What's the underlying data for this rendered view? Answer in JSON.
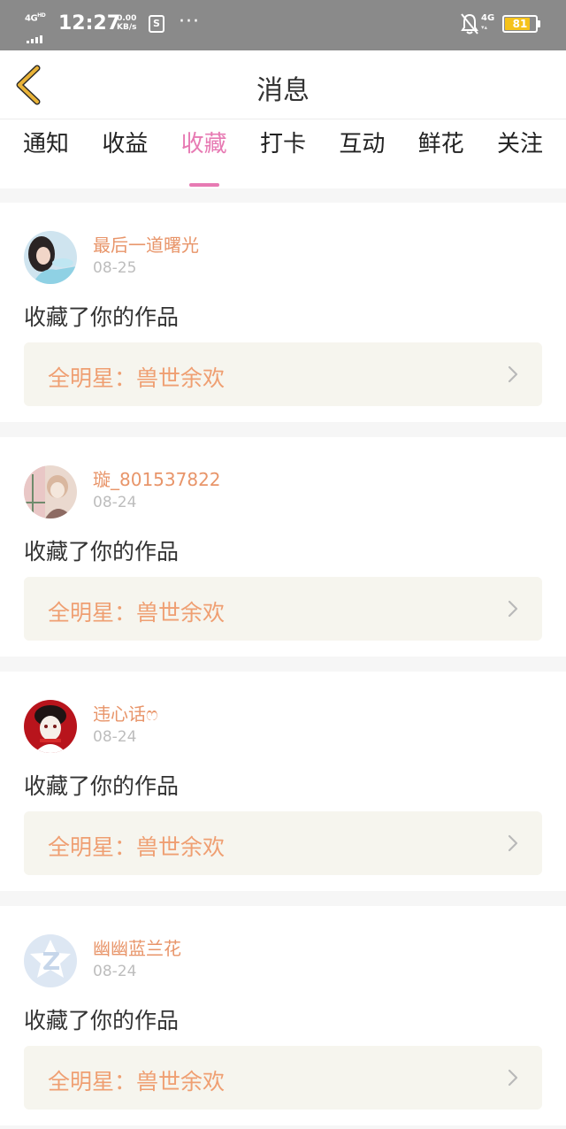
{
  "status_bar": {
    "network": "4G",
    "network_sup": "HD",
    "time": "12:27",
    "speed_value": "0.00",
    "speed_unit": "KB/s",
    "more": "···",
    "network_right": "4G",
    "battery": "81",
    "battery_level": 0.81,
    "battery_color": "#f5c21a"
  },
  "header": {
    "title": "消息",
    "back_icon": "chevron-left-icon",
    "back_color": "#e9b338"
  },
  "tabs": [
    {
      "label": "通知",
      "active": false
    },
    {
      "label": "收益",
      "active": false
    },
    {
      "label": "收藏",
      "active": true
    },
    {
      "label": "打卡",
      "active": false
    },
    {
      "label": "互动",
      "active": false
    },
    {
      "label": "鲜花",
      "active": false
    },
    {
      "label": "关注",
      "active": false
    }
  ],
  "accent_color": "#e77ab3",
  "messages": [
    {
      "name": "最后一道曙光",
      "date": "08-25",
      "action": "收藏了你的作品",
      "work": "全明星：兽世余欢",
      "avatar": "photo-avatar"
    },
    {
      "name": "璇_801537822",
      "date": "08-24",
      "action": "收藏了你的作品",
      "work": "全明星：兽世余欢",
      "avatar": "illustration-avatar"
    },
    {
      "name": "违心话ෆ",
      "date": "08-24",
      "action": "收藏了你的作品",
      "work": "全明星：兽世余欢",
      "avatar": "anime-avatar"
    },
    {
      "name": "幽幽蓝兰花",
      "date": "08-24",
      "action": "收藏了你的作品",
      "work": "全明星：兽世余欢",
      "avatar": "default-z-avatar"
    }
  ]
}
